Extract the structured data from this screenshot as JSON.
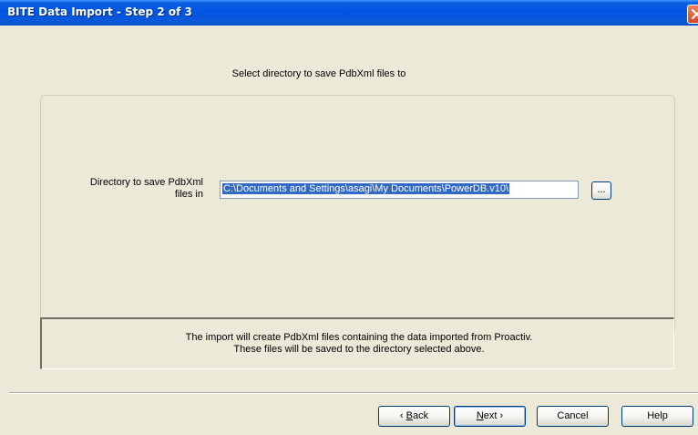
{
  "window": {
    "title": "BITE Data Import - Step 2 of 3"
  },
  "instruction": "Select directory to save PdbXml files to",
  "directory": {
    "label_line1": "Directory to save PdbXml",
    "label_line2": "files in",
    "value": "C:\\Documents and Settings\\asagi\\My Documents\\PowerDB.v10\\",
    "browse_label": "..."
  },
  "info": {
    "line1": "The import will create PdbXml files containing the data imported from Proactiv.",
    "line2": "These files will be saved to the directory selected above."
  },
  "buttons": {
    "back_prefix": "‹ ",
    "back_mnemonic": "B",
    "back_rest": "ack",
    "next_mnemonic": "N",
    "next_rest": "ext ›",
    "cancel": "Cancel",
    "help": "Help"
  },
  "icons": {
    "close": "close-icon"
  }
}
